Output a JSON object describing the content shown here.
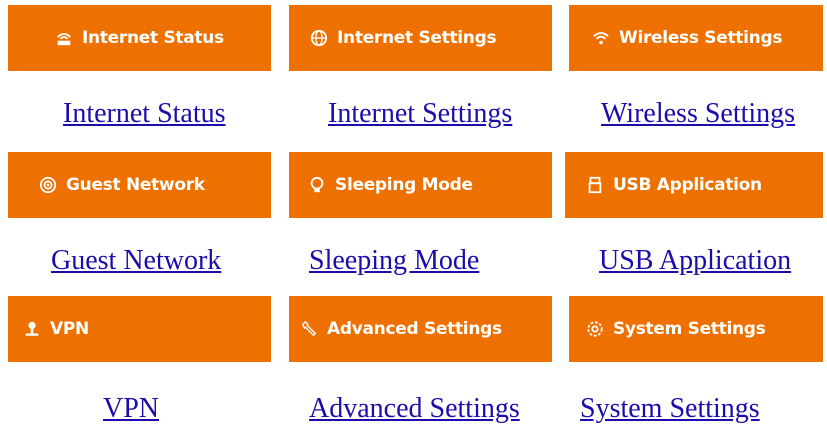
{
  "tiles": [
    {
      "label": "Internet Status",
      "icon": "router-icon"
    },
    {
      "label": "Internet Settings",
      "icon": "globe-icon"
    },
    {
      "label": "Wireless Settings",
      "icon": "wifi-icon"
    },
    {
      "label": "Guest Network",
      "icon": "guest-network-icon"
    },
    {
      "label": "Sleeping Mode",
      "icon": "bulb-icon"
    },
    {
      "label": "USB Application",
      "icon": "usb-icon"
    },
    {
      "label": "VPN",
      "icon": "vpn-icon"
    },
    {
      "label": "Advanced Settings",
      "icon": "wrench-icon"
    },
    {
      "label": "System Settings",
      "icon": "gear-icon"
    }
  ],
  "links": [
    "Internet Status",
    "Internet Settings",
    "Wireless Settings",
    "Guest Network",
    "Sleeping Mode",
    "USB Application",
    "VPN",
    "Advanced Settings",
    "System Settings"
  ],
  "colors": {
    "tile_bg": "#ee7100",
    "tile_text": "#ffffff",
    "link": "#1a0dab"
  }
}
